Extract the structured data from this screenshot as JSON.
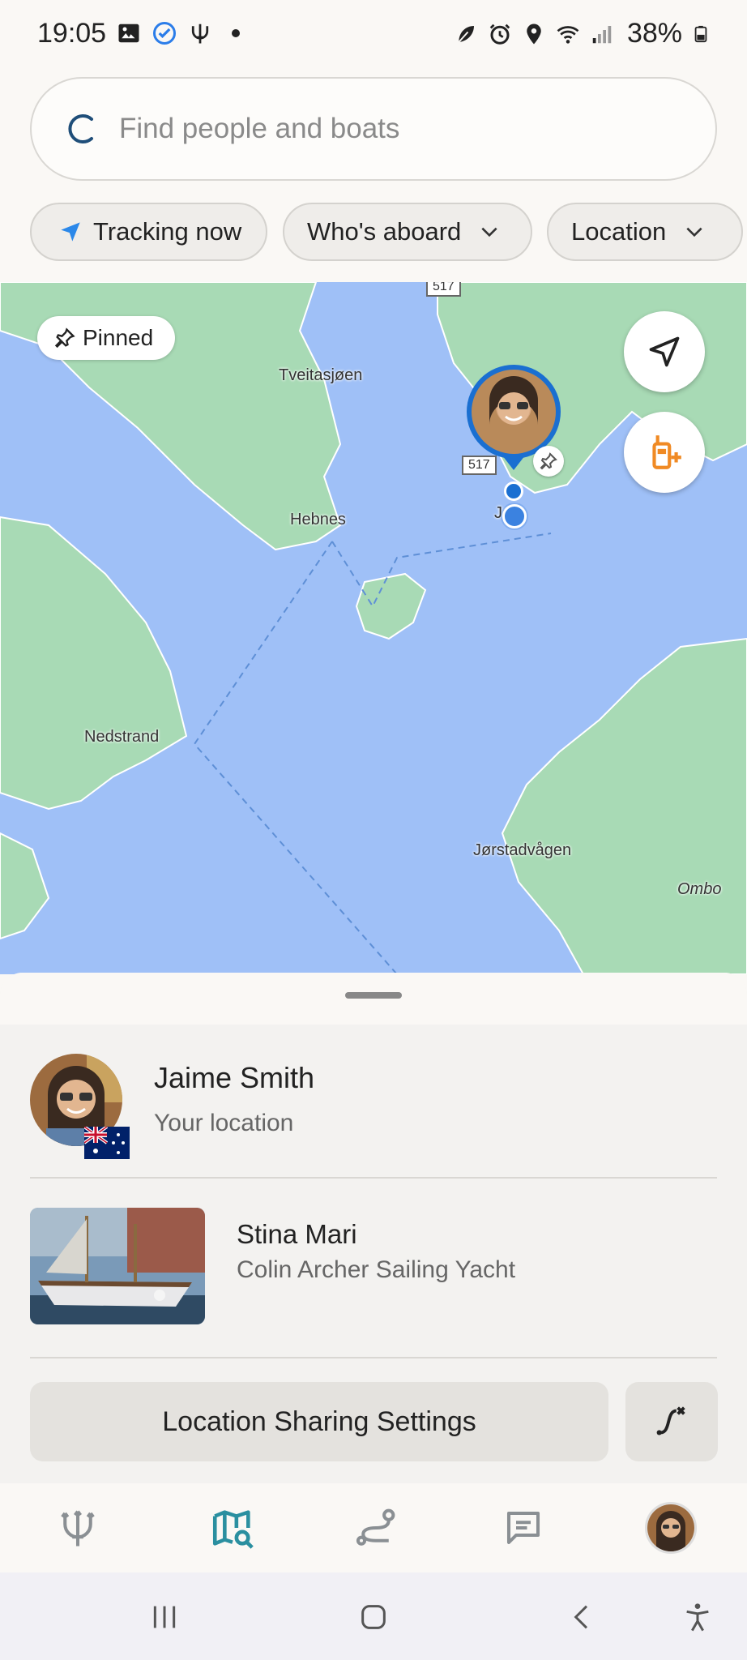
{
  "status_bar": {
    "time": "19:05",
    "battery_percent": "38%",
    "left_icons": [
      "gallery-icon",
      "check-badge-icon",
      "trident-icon",
      "dot-icon"
    ],
    "right_icons": [
      "leaf-icon",
      "alarm-icon",
      "location-icon",
      "wifi-icon",
      "signal-icon",
      "battery-icon"
    ]
  },
  "search": {
    "placeholder": "Find people and boats"
  },
  "filters": {
    "tracking": "Tracking now",
    "whos_aboard": "Who's aboard",
    "location": "Location"
  },
  "map": {
    "pinned_label": "Pinned",
    "places": {
      "tveitasjoen": "Tveitasjøen",
      "hebnes": "Hebnes",
      "nedstrand": "Nedstrand",
      "jorstadvagen": "Jørstadvågen",
      "ombo": "Ombo",
      "jelsa": "Ja"
    },
    "road_numbers": {
      "top": "517",
      "marker": "517"
    },
    "colors": {
      "water": "#9fc0f7",
      "land": "#a8dab5",
      "marker_ring": "#1a6fd1",
      "accent_orange": "#f08a24"
    }
  },
  "sheet": {
    "person": {
      "name": "Jaime Smith",
      "subtitle": "Your location"
    },
    "boat": {
      "name": "Stina Mari",
      "subtitle": "Colin Archer Sailing Yacht"
    },
    "settings_button": "Location Sharing Settings"
  },
  "bottom_nav": {
    "items": [
      "trident-icon",
      "map-search-icon",
      "route-icon",
      "chat-icon",
      "profile-avatar"
    ],
    "active_color": "#2a8fa0"
  }
}
